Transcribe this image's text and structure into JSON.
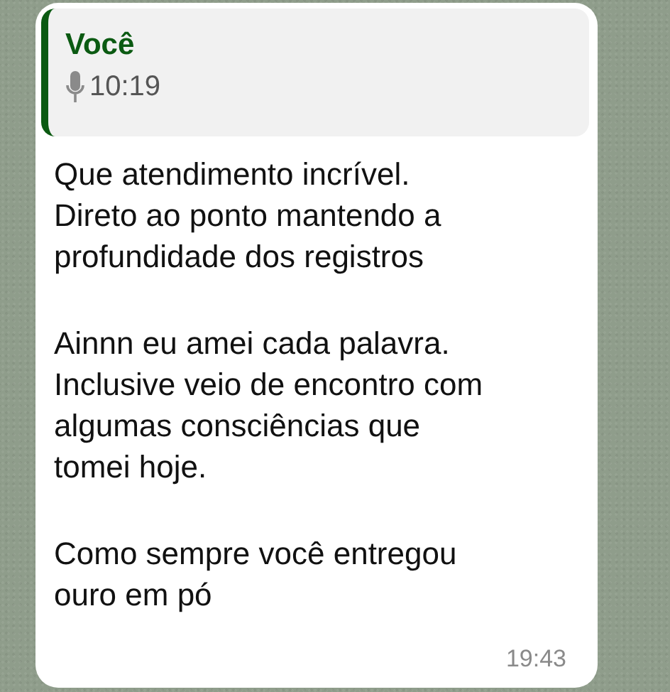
{
  "message": {
    "quote": {
      "author": "Você",
      "kind": "voice",
      "duration": "10:19"
    },
    "paragraphs": [
      "Que atendimento incrível.\nDireto ao ponto mantendo a\nprofundidade dos registros",
      "Ainnn eu amei cada palavra.\nInclusive veio de encontro com\nalgumas consciências que\ntomei hoje.",
      "Como sempre você entregou\nouro em pó"
    ],
    "time": "19:43"
  }
}
